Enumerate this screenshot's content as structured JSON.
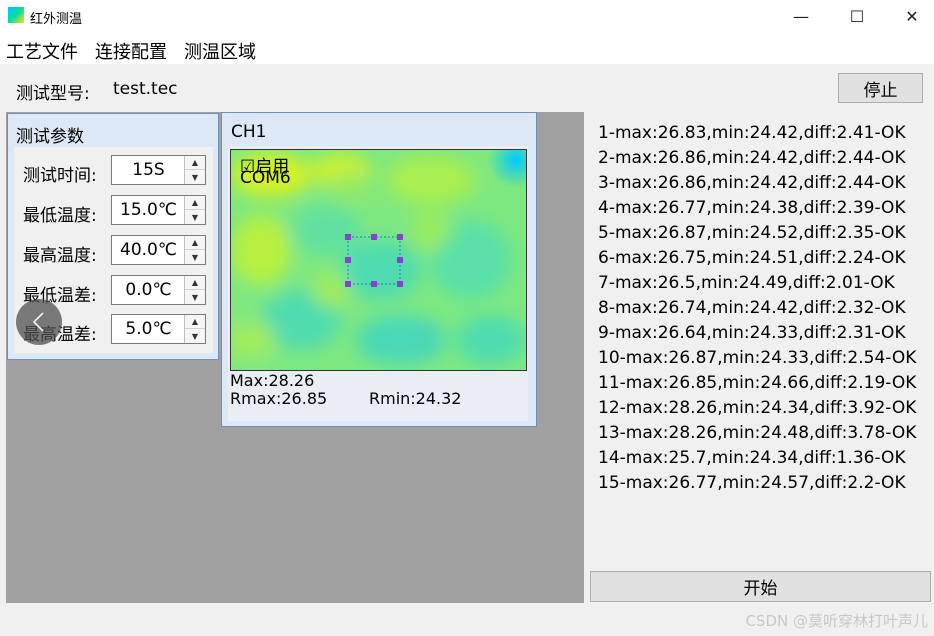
{
  "window": {
    "title": "红外测温",
    "minimize": "—",
    "maximize": "☐",
    "close": "✕"
  },
  "menu": {
    "items": [
      "工艺文件",
      "连接配置",
      "测温区域"
    ]
  },
  "model": {
    "label": "测试型号:",
    "value": "test.tec"
  },
  "buttons": {
    "stop": "停止",
    "start": "开始"
  },
  "params": {
    "title": "测试参数",
    "rows": [
      {
        "label": "测试时间:",
        "value": "15S"
      },
      {
        "label": "最低温度:",
        "value": "15.0℃"
      },
      {
        "label": "最高温度:",
        "value": "40.0℃"
      },
      {
        "label": "最低温差:",
        "value": "0.0℃"
      },
      {
        "label": "最高温差:",
        "value": "5.0℃"
      }
    ]
  },
  "channel": {
    "title": "CH1",
    "enable_label": "☑启用",
    "port": "COM6",
    "max": "Max:28.26",
    "rmax": "Rmax:26.85",
    "rmin": "Rmin:24.32"
  },
  "results": [
    "1-max:26.83,min:24.42,diff:2.41-OK",
    "2-max:26.86,min:24.42,diff:2.44-OK",
    "3-max:26.86,min:24.42,diff:2.44-OK",
    "4-max:26.77,min:24.38,diff:2.39-OK",
    "5-max:26.87,min:24.52,diff:2.35-OK",
    "6-max:26.75,min:24.51,diff:2.24-OK",
    "7-max:26.5,min:24.49,diff:2.01-OK",
    "8-max:26.74,min:24.42,diff:2.32-OK",
    "9-max:26.64,min:24.33,diff:2.31-OK",
    "10-max:26.87,min:24.33,diff:2.54-OK",
    "11-max:26.85,min:24.66,diff:2.19-OK",
    "12-max:28.26,min:24.34,diff:3.92-OK",
    "13-max:28.26,min:24.48,diff:3.78-OK",
    "14-max:25.7,min:24.34,diff:1.36-OK",
    "15-max:26.77,min:24.57,diff:2.2-OK"
  ],
  "watermark": "CSDN @莫听穿林打叶声儿",
  "colors": {
    "accent_panel": "#dce8f5",
    "workspace": "#a0a0a0",
    "roi": "#8a3fd1"
  }
}
